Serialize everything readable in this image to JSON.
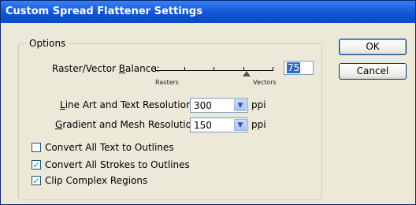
{
  "window": {
    "title": "Custom Spread Flattener Settings"
  },
  "options": {
    "legend": "Options",
    "balance": {
      "label_pre": "Raster/Vector ",
      "label_accel": "B",
      "label_post": "alance:",
      "left_label": "Rasters",
      "right_label": "Vectors",
      "value": "75",
      "value_fraction": 0.75
    },
    "line_art": {
      "label_accel": "L",
      "label_post": "ine Art and Text Resolution:",
      "value": "300",
      "unit": "ppi"
    },
    "gradient": {
      "label_accel": "G",
      "label_post": "radient and Mesh Resolution:",
      "value": "150",
      "unit": "ppi"
    },
    "checkboxes": [
      {
        "label": "Convert All Text to Outlines",
        "checked": false
      },
      {
        "label": "Convert All Strokes to Outlines",
        "checked": true
      },
      {
        "label": "Clip Complex Regions",
        "checked": true
      }
    ]
  },
  "buttons": {
    "ok": "OK",
    "cancel": "Cancel"
  },
  "icons": {
    "dropdown": "chevron-down-icon",
    "slider_thumb": "slider-thumb-icon",
    "check": "checkmark-icon"
  }
}
